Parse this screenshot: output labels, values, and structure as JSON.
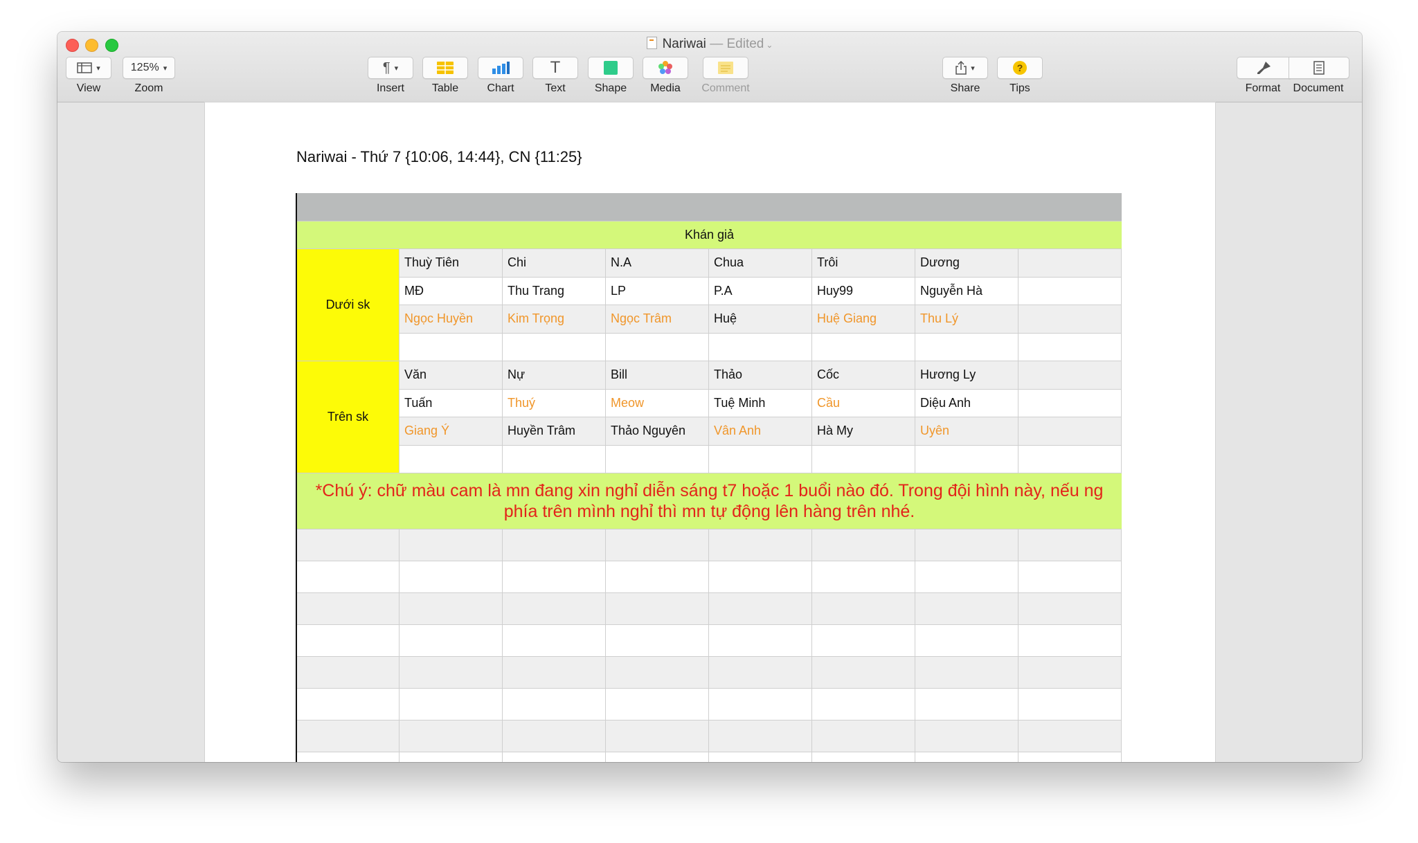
{
  "window": {
    "title": "Nariwai",
    "status": "— Edited"
  },
  "toolbar": {
    "view_label": "View",
    "zoom_value": "125%",
    "zoom_label": "Zoom",
    "insert_label": "Insert",
    "table_label": "Table",
    "chart_label": "Chart",
    "text_label": "Text",
    "shape_label": "Shape",
    "media_label": "Media",
    "comment_label": "Comment",
    "share_label": "Share",
    "tips_label": "Tips",
    "format_label": "Format",
    "document_label": "Document"
  },
  "document": {
    "heading": "Nariwai - Thứ 7 {10:06, 14:44}, CN {11:25}",
    "table": {
      "section_header": "Khán giả",
      "groups": [
        {
          "label": "Dưới sk",
          "rows": [
            [
              {
                "t": "Thuỳ Tiên",
                "o": false
              },
              {
                "t": "Chi",
                "o": false
              },
              {
                "t": "N.A",
                "o": false
              },
              {
                "t": "Chua",
                "o": false
              },
              {
                "t": "Trôi",
                "o": false
              },
              {
                "t": "Dương",
                "o": false
              },
              {
                "t": "",
                "o": false
              }
            ],
            [
              {
                "t": "MĐ",
                "o": false
              },
              {
                "t": "Thu Trang",
                "o": false
              },
              {
                "t": "LP",
                "o": false
              },
              {
                "t": "P.A",
                "o": false
              },
              {
                "t": "Huy99",
                "o": false
              },
              {
                "t": "Nguyễn Hà",
                "o": false
              },
              {
                "t": "",
                "o": false
              }
            ],
            [
              {
                "t": "Ngọc Huyền",
                "o": true
              },
              {
                "t": "Kim Trọng",
                "o": true
              },
              {
                "t": "Ngọc Trâm",
                "o": true
              },
              {
                "t": "Huệ",
                "o": false
              },
              {
                "t": "Huệ Giang",
                "o": true
              },
              {
                "t": "Thu Lý",
                "o": true
              },
              {
                "t": "",
                "o": false
              }
            ],
            [
              {
                "t": "",
                "o": false
              },
              {
                "t": "",
                "o": false
              },
              {
                "t": "",
                "o": false
              },
              {
                "t": "",
                "o": false
              },
              {
                "t": "",
                "o": false
              },
              {
                "t": "",
                "o": false
              },
              {
                "t": "",
                "o": false
              }
            ]
          ]
        },
        {
          "label": "Trên sk",
          "rows": [
            [
              {
                "t": "Văn",
                "o": false
              },
              {
                "t": "Nự",
                "o": false
              },
              {
                "t": "Bill",
                "o": false
              },
              {
                "t": "Thảo",
                "o": false
              },
              {
                "t": "Cốc",
                "o": false
              },
              {
                "t": "Hương Ly",
                "o": false
              },
              {
                "t": "",
                "o": false
              }
            ],
            [
              {
                "t": "Tuấn",
                "o": false
              },
              {
                "t": "Thuý",
                "o": true
              },
              {
                "t": "Meow",
                "o": true
              },
              {
                "t": "Tuệ Minh",
                "o": false
              },
              {
                "t": "Cầu",
                "o": true
              },
              {
                "t": "Diệu Anh",
                "o": false
              },
              {
                "t": "",
                "o": false
              }
            ],
            [
              {
                "t": "Giang Ý",
                "o": true
              },
              {
                "t": "Huyền Trâm",
                "o": false
              },
              {
                "t": "Thảo Nguyên",
                "o": false
              },
              {
                "t": "Vân Anh",
                "o": true
              },
              {
                "t": "Hà My",
                "o": false
              },
              {
                "t": "Uyên",
                "o": true
              },
              {
                "t": "",
                "o": false
              }
            ],
            [
              {
                "t": "",
                "o": false
              },
              {
                "t": "",
                "o": false
              },
              {
                "t": "",
                "o": false
              },
              {
                "t": "",
                "o": false
              },
              {
                "t": "",
                "o": false
              },
              {
                "t": "",
                "o": false
              },
              {
                "t": "",
                "o": false
              }
            ]
          ]
        }
      ],
      "note_line1": "*Chú ý: chữ màu cam là mn đang xin nghỉ diễn sáng t7 hoặc 1 buổi nào đó. Trong đội hình này, nếu ng",
      "note_line2": "phía trên mình nghỉ thì mn tự động lên hàng trên nhé."
    }
  },
  "colors": {
    "header_gray": "#b9bbbb",
    "band_green": "#d4f87a",
    "group_yellow": "#fdfb07",
    "orange_text": "#f0962a",
    "note_red": "#e3241a"
  }
}
